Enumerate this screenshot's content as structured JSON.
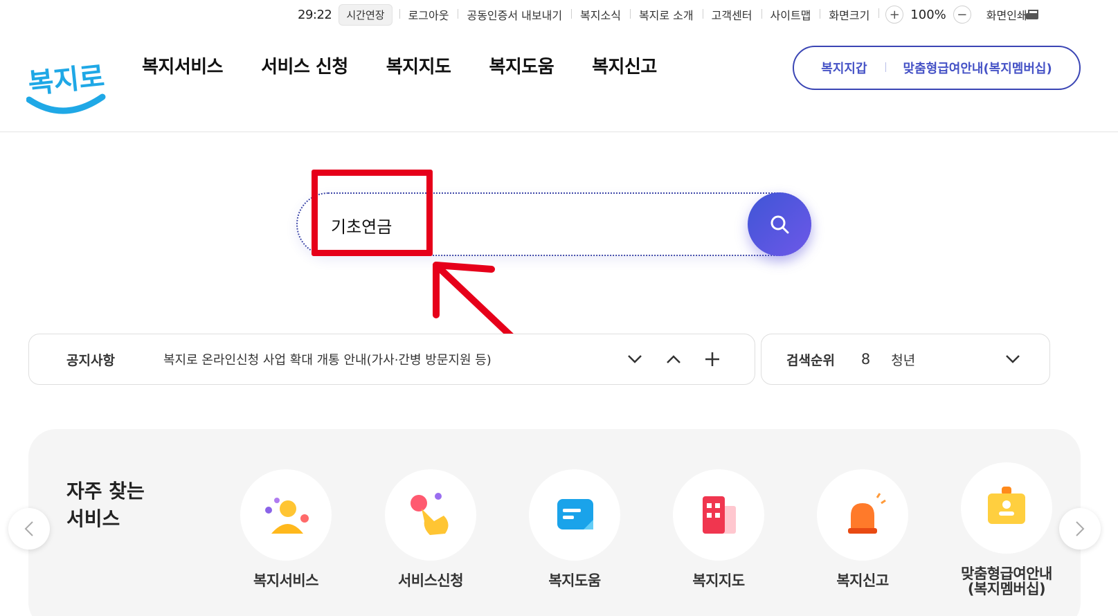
{
  "utility": {
    "timer": "29:22",
    "extend_label": "시간연장",
    "links": [
      "로그아웃",
      "공동인증서 내보내기",
      "복지소식",
      "복지로 소개",
      "고객센터",
      "사이트맵",
      "화면크기"
    ],
    "zoom_in": "+",
    "zoom_value": "100%",
    "zoom_out": "−",
    "print_label": "화면인쇄"
  },
  "header": {
    "logo_text": "복지로",
    "nav": [
      "복지서비스",
      "서비스 신청",
      "복지지도",
      "복지도움",
      "복지신고"
    ],
    "pill_links": [
      "복지지갑",
      "맞춤형급여안내(복지멤버십)"
    ]
  },
  "search": {
    "value": "기초연금"
  },
  "notice": {
    "label": "공지사항",
    "text": "복지로 온라인신청 사업 확대 개통 안내(가사·간병 방문지원 등)"
  },
  "ranking": {
    "label": "검색순위",
    "number": "8",
    "term": "청년"
  },
  "frequent": {
    "title_line1": "자주 찾는",
    "title_line2": "서비스",
    "items": [
      {
        "label": "복지서비스"
      },
      {
        "label": "서비스신청"
      },
      {
        "label": "복지도움"
      },
      {
        "label": "복지지도"
      },
      {
        "label": "복지신고"
      },
      {
        "label": "맞춤형급여안내\n(복지멤버십)"
      }
    ]
  },
  "colors": {
    "brand_blue": "#3a45b4",
    "search_gradient_start": "#3f55d6",
    "search_gradient_end": "#6d58e8",
    "annotation_red": "#e6001a",
    "logo_sky": "#1fa8e6"
  },
  "icons": {
    "search_button": "search-icon",
    "print": "printer-icon",
    "notice_controls": [
      "chevron-down-icon",
      "chevron-up-icon",
      "plus-icon"
    ],
    "ranking_toggle": "chevron-down-icon",
    "carousel": [
      "chevron-left-icon",
      "chevron-right-icon"
    ]
  }
}
